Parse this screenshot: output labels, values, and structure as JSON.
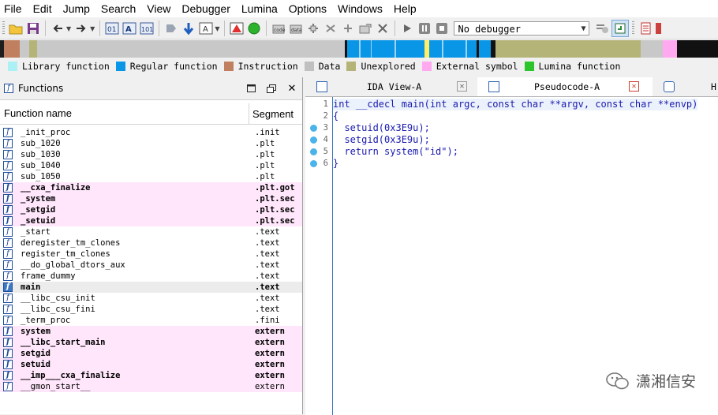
{
  "menubar": {
    "items": [
      "File",
      "Edit",
      "Jump",
      "Search",
      "View",
      "Debugger",
      "Lumina",
      "Options",
      "Windows",
      "Help"
    ]
  },
  "toolbar": {
    "debugger_select": "No debugger"
  },
  "legend": {
    "items": [
      {
        "label": "Library function",
        "color": "#aaf0f4"
      },
      {
        "label": "Regular function",
        "color": "#0a96e6"
      },
      {
        "label": "Instruction",
        "color": "#c08060"
      },
      {
        "label": "Data",
        "color": "#c0c0c0"
      },
      {
        "label": "Unexplored",
        "color": "#b4b478"
      },
      {
        "label": "External symbol",
        "color": "#ffaaf0"
      },
      {
        "label": "Lumina function",
        "color": "#2cc62c"
      }
    ]
  },
  "functions_panel": {
    "title": "Functions",
    "columns": {
      "name": "Function name",
      "segment": "Segment"
    },
    "rows": [
      {
        "name": "_init_proc",
        "segment": ".init",
        "style": "normal"
      },
      {
        "name": "sub_1020",
        "segment": ".plt",
        "style": "normal"
      },
      {
        "name": "sub_1030",
        "segment": ".plt",
        "style": "normal"
      },
      {
        "name": "sub_1040",
        "segment": ".plt",
        "style": "normal"
      },
      {
        "name": "sub_1050",
        "segment": ".plt",
        "style": "normal"
      },
      {
        "name": "__cxa_finalize",
        "segment": ".plt.got",
        "style": "pink"
      },
      {
        "name": "_system",
        "segment": ".plt.sec",
        "style": "pink"
      },
      {
        "name": "_setgid",
        "segment": ".plt.sec",
        "style": "pink"
      },
      {
        "name": "_setuid",
        "segment": ".plt.sec",
        "style": "pink"
      },
      {
        "name": "_start",
        "segment": ".text",
        "style": "normal"
      },
      {
        "name": "deregister_tm_clones",
        "segment": ".text",
        "style": "normal"
      },
      {
        "name": "register_tm_clones",
        "segment": ".text",
        "style": "normal"
      },
      {
        "name": "__do_global_dtors_aux",
        "segment": ".text",
        "style": "normal"
      },
      {
        "name": "frame_dummy",
        "segment": ".text",
        "style": "normal"
      },
      {
        "name": "main",
        "segment": ".text",
        "style": "selected"
      },
      {
        "name": "__libc_csu_init",
        "segment": ".text",
        "style": "normal"
      },
      {
        "name": "__libc_csu_fini",
        "segment": ".text",
        "style": "normal"
      },
      {
        "name": "_term_proc",
        "segment": ".fini",
        "style": "normal"
      },
      {
        "name": "system",
        "segment": "extern",
        "style": "pink"
      },
      {
        "name": "__libc_start_main",
        "segment": "extern",
        "style": "pink"
      },
      {
        "name": "setgid",
        "segment": "extern",
        "style": "pink"
      },
      {
        "name": "setuid",
        "segment": "extern",
        "style": "pink"
      },
      {
        "name": "__imp___cxa_finalize",
        "segment": "extern",
        "style": "pink"
      },
      {
        "name": "__gmon_start__",
        "segment": "extern",
        "style": "pink-light"
      }
    ]
  },
  "tabs": [
    {
      "label": "IDA View-A",
      "active": false
    },
    {
      "label": "Pseudocode-A",
      "active": true
    },
    {
      "label": "H",
      "active": false
    }
  ],
  "code": {
    "lines": [
      {
        "num": "1",
        "text": "int __cdecl main(int argc, const char **argv, const char **envp)",
        "bp": false
      },
      {
        "num": "2",
        "text": "{",
        "bp": false
      },
      {
        "num": "3",
        "text": "  setuid(0x3E9u);",
        "bp": true
      },
      {
        "num": "4",
        "text": "  setgid(0x3E9u);",
        "bp": true
      },
      {
        "num": "5",
        "text": "  return system(\"id\");",
        "bp": true
      },
      {
        "num": "6",
        "text": "}",
        "bp": true
      }
    ]
  },
  "watermark": {
    "text": "潇湘信安"
  }
}
